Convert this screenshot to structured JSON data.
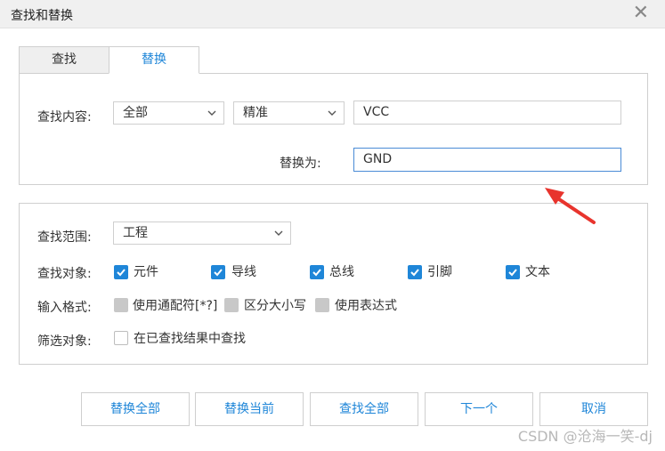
{
  "window": {
    "title": "查找和替换"
  },
  "tabs": [
    {
      "label": "查找",
      "active": false
    },
    {
      "label": "替换",
      "active": true
    }
  ],
  "find": {
    "label": "查找内容:",
    "scope_select": "全部",
    "mode_select": "精准",
    "find_value": "VCC",
    "replace_label": "替换为:",
    "replace_value": "GND"
  },
  "options": {
    "range_label": "查找范围:",
    "range_value": "工程",
    "objects_label": "查找对象:",
    "objects": [
      {
        "label": "元件",
        "checked": true
      },
      {
        "label": "导线",
        "checked": true
      },
      {
        "label": "总线",
        "checked": true
      },
      {
        "label": "引脚",
        "checked": true
      },
      {
        "label": "文本",
        "checked": true
      }
    ],
    "format_label": "输入格式:",
    "formats": [
      {
        "label": "使用通配符[*?]",
        "checked": false
      },
      {
        "label": "区分大小写",
        "checked": false
      },
      {
        "label": "使用表达式",
        "checked": false
      }
    ],
    "filter_label": "筛选对象:",
    "filter_option": {
      "label": "在已查找结果中查找",
      "checked": false
    }
  },
  "buttons": {
    "replace_all": "替换全部",
    "replace_current": "替换当前",
    "find_all": "查找全部",
    "next": "下一个",
    "cancel": "取消"
  },
  "watermark": "CSDN @沧海一笑-dj",
  "colors": {
    "accent": "#1f86d8",
    "annotation_arrow": "#e8342d",
    "border": "#cfcfcf"
  }
}
